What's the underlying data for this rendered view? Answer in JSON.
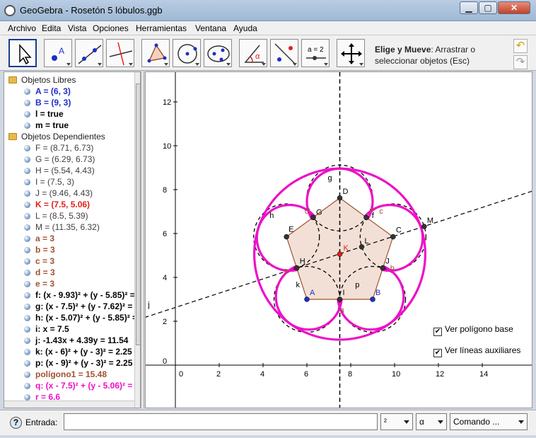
{
  "window": {
    "title": "GeoGebra - Rosetón 5 lóbulos.ggb",
    "minimize": "▁",
    "maximize": "▢",
    "close": "✕"
  },
  "menu": [
    "Archivo",
    "Edita",
    "Vista",
    "Opciones",
    "Herramientas",
    "Ventana",
    "Ayuda"
  ],
  "toolbar": {
    "tools": [
      {
        "name": "move-tool",
        "icon": "arrow-cursor-icon"
      },
      {
        "name": "point-tool",
        "icon": "point-icon"
      },
      {
        "name": "line-tool",
        "icon": "line-through-points-icon"
      },
      {
        "name": "perpendicular-tool",
        "icon": "perpendicular-line-icon"
      },
      {
        "name": "polygon-tool",
        "icon": "polygon-icon"
      },
      {
        "name": "circle-tool",
        "icon": "circle-center-point-icon"
      },
      {
        "name": "conic-tool",
        "icon": "ellipse-icon"
      },
      {
        "name": "angle-tool",
        "icon": "angle-icon"
      },
      {
        "name": "reflect-tool",
        "icon": "reflect-icon"
      },
      {
        "name": "slider-tool",
        "icon": "slider-icon"
      },
      {
        "name": "move-graphics-tool",
        "icon": "move-view-icon"
      }
    ],
    "slider_label": "a = 2",
    "angle_label": "α",
    "help_title": "Elige y Mueve",
    "help_text": ": Arrastrar o seleccionar objetos (Esc)",
    "undo": "↶",
    "redo": "↷"
  },
  "algebra": {
    "free_header": "Objetos Libres",
    "free": [
      {
        "text": "A = (6, 3)",
        "color": "#1c2fc8"
      },
      {
        "text": "B = (9, 3)",
        "color": "#1c2fc8"
      },
      {
        "text": "l = true",
        "color": "#000000"
      },
      {
        "text": "m = true",
        "color": "#000000"
      }
    ],
    "dependent_header": "Objetos Dependientes",
    "dependent": [
      {
        "text": "F = (8.71, 6.73)",
        "color": "#404040"
      },
      {
        "text": "G = (6.29, 6.73)",
        "color": "#404040"
      },
      {
        "text": "H = (5.54, 4.43)",
        "color": "#404040"
      },
      {
        "text": "I = (7.5, 3)",
        "color": "#404040"
      },
      {
        "text": "J = (9.46, 4.43)",
        "color": "#404040"
      },
      {
        "text": "K = (7.5, 5.06)",
        "color": "#e0201a"
      },
      {
        "text": "L = (8.5, 5.39)",
        "color": "#404040"
      },
      {
        "text": "M = (11.35, 6.32)",
        "color": "#404040"
      },
      {
        "text": "a = 3",
        "color": "#a0522d"
      },
      {
        "text": "b = 3",
        "color": "#a0522d"
      },
      {
        "text": "c = 3",
        "color": "#a0522d"
      },
      {
        "text": "d = 3",
        "color": "#a0522d"
      },
      {
        "text": "e = 3",
        "color": "#a0522d"
      },
      {
        "text": "f: (x - 9.93)² + (y - 5.85)² =",
        "color": "#000000"
      },
      {
        "text": "g: (x - 7.5)² + (y - 7.62)² =",
        "color": "#000000"
      },
      {
        "text": "h: (x - 5.07)² + (y - 5.85)² =",
        "color": "#000000"
      },
      {
        "text": "i: x = 7.5",
        "color": "#000000"
      },
      {
        "text": "j: -1.43x + 4.39y = 11.54",
        "color": "#000000"
      },
      {
        "text": "k: (x - 6)² + (y - 3)² = 2.25",
        "color": "#000000"
      },
      {
        "text": "p: (x - 9)² + (y - 3)² = 2.25",
        "color": "#000000"
      },
      {
        "text": "polígono1 = 15.48",
        "color": "#a0522d"
      },
      {
        "text": "q: (x - 7.5)² + (y - 5.06)² =",
        "color": "#ee10c8"
      },
      {
        "text": "r = 6.6",
        "color": "#ee10c8"
      }
    ]
  },
  "graphics": {
    "x_ticks": [
      "0",
      "2",
      "4",
      "6",
      "8",
      "10",
      "12",
      "14"
    ],
    "y_ticks": [
      "0",
      "2",
      "4",
      "6",
      "8",
      "10",
      "12"
    ],
    "point_labels": {
      "A": "A",
      "B": "B",
      "C": "C",
      "D": "D",
      "E": "E",
      "F": "F",
      "G": "G",
      "H": "H",
      "I": "I",
      "J": "J",
      "K": "K",
      "L": "L",
      "M": "M"
    },
    "curve_labels": {
      "f": "f",
      "g": "g",
      "h": "h",
      "i": "i",
      "j": "j",
      "k": "k",
      "p": "p",
      "a": "a",
      "b": "b",
      "c": "c",
      "d": "d",
      "e": "e"
    },
    "checkbox_polygon": "Ver polígono base",
    "checkbox_aux": "Ver líneas auxiliares",
    "checkbox_mark": "✔",
    "colors": {
      "magenta": "#ee10c8",
      "brown": "#a0522d",
      "polygon_fill": "#f2e0d6",
      "point_blue": "#1c2fc8",
      "point_red": "#e0201a"
    }
  },
  "input": {
    "label": "Entrada:",
    "value": "",
    "exponent_combo": "²",
    "symbol_combo": "α",
    "command_combo": "Comando ..."
  }
}
